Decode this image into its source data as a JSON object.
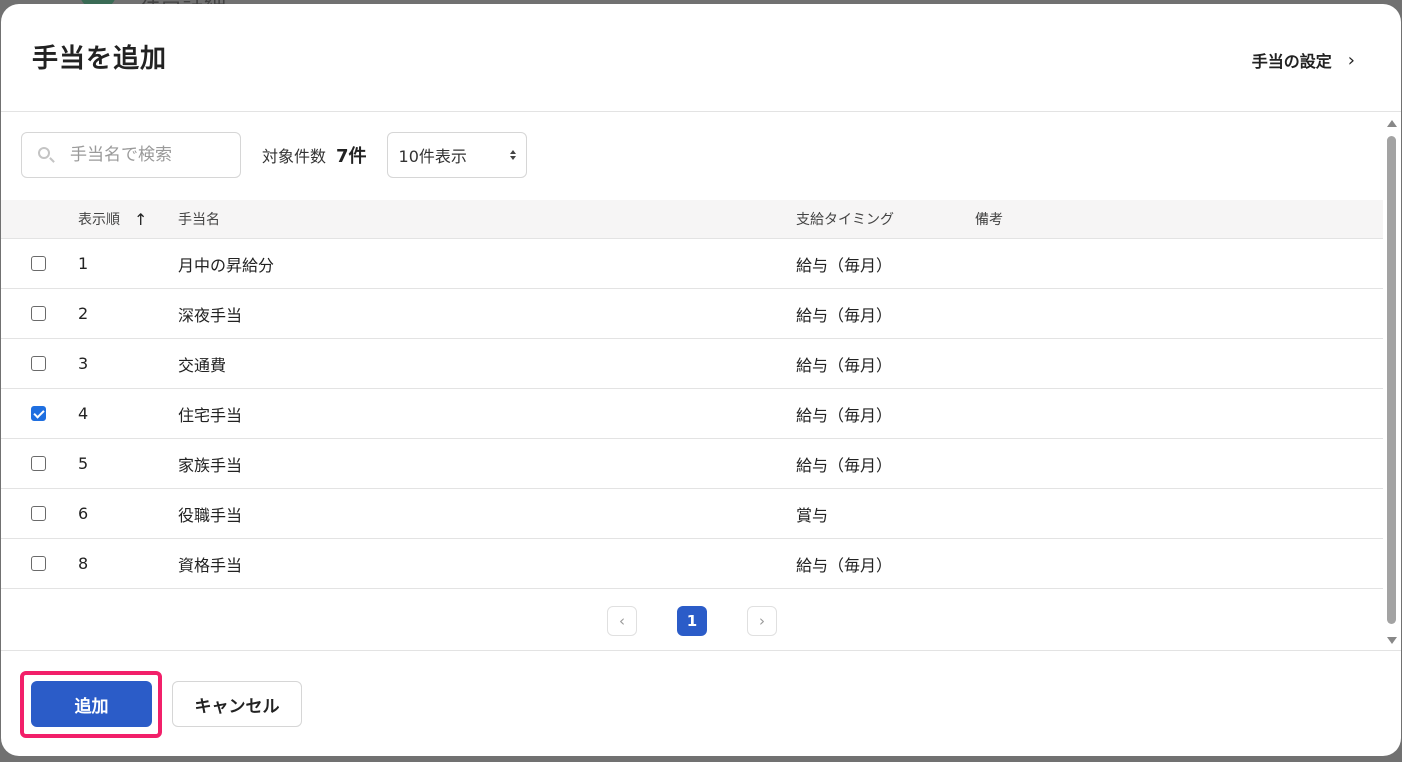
{
  "backdrop": {
    "title": "社員詳細"
  },
  "modal": {
    "title": "手当を追加",
    "settings_link": "手当の設定",
    "settings_chevron": "›"
  },
  "toolbar": {
    "search_placeholder": "手当名で検索",
    "count_label": "対象件数",
    "count_value": "7件",
    "page_size": "10件表示"
  },
  "table": {
    "headers": {
      "order": "表示順",
      "sort_arrow": "↑",
      "name": "手当名",
      "timing": "支給タイミング",
      "note": "備考"
    },
    "rows": [
      {
        "order": "1",
        "name": "月中の昇給分",
        "timing": "給与（毎月）",
        "note": "",
        "checked": false
      },
      {
        "order": "2",
        "name": "深夜手当",
        "timing": "給与（毎月）",
        "note": "",
        "checked": false
      },
      {
        "order": "3",
        "name": "交通費",
        "timing": "給与（毎月）",
        "note": "",
        "checked": false
      },
      {
        "order": "4",
        "name": "住宅手当",
        "timing": "給与（毎月）",
        "note": "",
        "checked": true
      },
      {
        "order": "5",
        "name": "家族手当",
        "timing": "給与（毎月）",
        "note": "",
        "checked": false
      },
      {
        "order": "6",
        "name": "役職手当",
        "timing": "賞与",
        "note": "",
        "checked": false
      },
      {
        "order": "8",
        "name": "資格手当",
        "timing": "給与（毎月）",
        "note": "",
        "checked": false
      }
    ]
  },
  "pagination": {
    "prev": "‹",
    "current": "1",
    "next": "›"
  },
  "footer": {
    "add_label": "追加",
    "cancel_label": "キャンセル"
  },
  "colors": {
    "primary": "#2b5cc8",
    "highlight": "#f2206a",
    "checkbox_checked": "#1f6fe0"
  }
}
